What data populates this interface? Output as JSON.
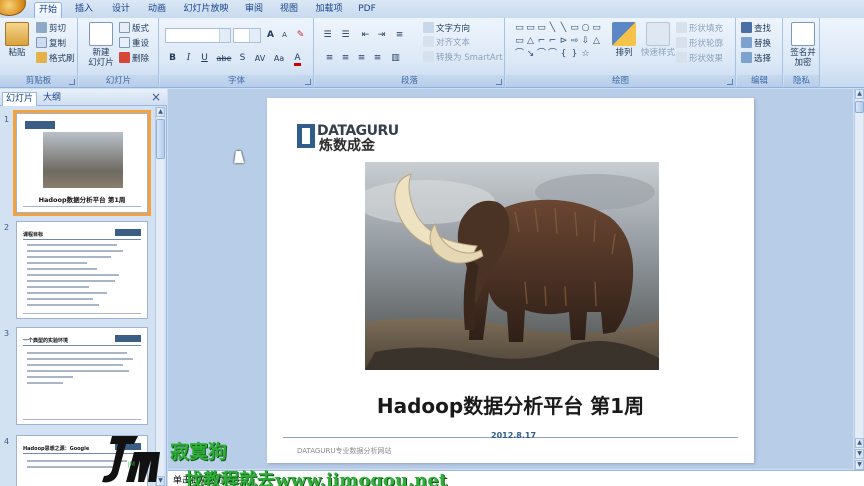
{
  "ribbon_tabs": [
    {
      "label": "开始",
      "active": true
    },
    {
      "label": "插入"
    },
    {
      "label": "设计"
    },
    {
      "label": "动画"
    },
    {
      "label": "幻灯片放映"
    },
    {
      "label": "审阅"
    },
    {
      "label": "视图"
    },
    {
      "label": "加载项"
    },
    {
      "label": "PDF"
    }
  ],
  "clipboard": {
    "paste": "粘贴",
    "cut": "剪切",
    "copy": "复制",
    "format_painter": "格式刷",
    "group_label": "剪贴板"
  },
  "slides_group": {
    "new_slide_line1": "新建",
    "new_slide_line2": "幻灯片",
    "layout": "版式",
    "reset": "重设",
    "delete": "删除",
    "group_label": "幻灯片"
  },
  "font_group": {
    "group_label": "字体",
    "bold": "B",
    "italic": "I",
    "underline": "U",
    "strike": "abe",
    "shadow": "S",
    "spacing": "AV",
    "case": "Aa",
    "grow": "A",
    "shrink": "A"
  },
  "paragraph_group": {
    "text_direction": "文字方向",
    "align_text": "对齐文本",
    "smartart": "转换为 SmartArt",
    "group_label": "段落"
  },
  "drawing_group": {
    "arrange": "排列",
    "quick_styles": "快速样式",
    "shape_fill": "形状填充",
    "shape_outline": "形状轮廓",
    "shape_effects": "形状效果",
    "group_label": "绘图",
    "shapes": [
      "▭",
      "▭",
      "▭",
      "╲",
      "╲",
      "▭",
      "○",
      "▭",
      "▭",
      "△",
      "⌐",
      "⌐",
      "⊳",
      "⇨",
      "⇩",
      "△",
      "⌒",
      "↘",
      "⌒",
      "⌒",
      "{",
      "}",
      "☆"
    ]
  },
  "editing_group": {
    "find": "查找",
    "replace": "替换",
    "select": "选择",
    "group_label": "编辑"
  },
  "addin_group": {
    "sign_line1": "签名并",
    "sign_line2": "加密",
    "group_label": "隐私"
  },
  "left_pane": {
    "tab_slides": "幻灯片",
    "tab_outline": "大纲",
    "close": "×",
    "thumbnails": [
      {
        "num": "1",
        "title": "Hadoop数据分析平台 第1周"
      },
      {
        "num": "2",
        "title": "课程目标"
      },
      {
        "num": "3",
        "title": "一个典型的实验环境"
      },
      {
        "num": "4",
        "title": "Hadoop思想之源：Google"
      }
    ]
  },
  "slide": {
    "logo_top": "DATAGURU",
    "logo_bottom": "炼数成金",
    "title": "Hadoop数据分析平台 第1周",
    "date": "2012.8.17",
    "footer": "DATAGURU专业数据分析网站"
  },
  "watermark": {
    "line1": "寂寞狗",
    "line2": "找教程就去www.jimogou.net",
    "logo_text": "JM"
  },
  "notes": {
    "placeholder": "单击此处添加备注"
  }
}
